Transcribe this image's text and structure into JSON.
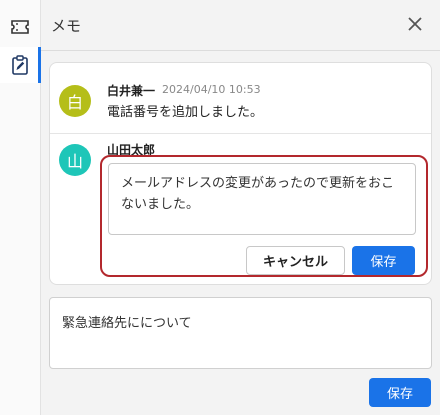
{
  "header": {
    "title": "メモ"
  },
  "comments": [
    {
      "avatar_char": "白",
      "author": "白井兼一",
      "time": "2024/04/10 10:53",
      "text": "電話番号を追加しました。",
      "avatar_color": "#b5be19"
    },
    {
      "avatar_char": "山",
      "author": "山田太郎",
      "avatar_color": "#1ec6b8"
    }
  ],
  "editing": {
    "text": "メールアドレスの変更があったので更新をおこないました。",
    "cancel_label": "キャンセル",
    "save_label": "保存"
  },
  "new_memo": {
    "value": "緊急連絡先にについて",
    "save_label": "保存"
  },
  "colors": {
    "accent": "#1a73e8",
    "highlight_border": "#b3282d"
  },
  "icons": [
    "ticket-icon",
    "clipboard-edit-icon",
    "close-icon"
  ]
}
